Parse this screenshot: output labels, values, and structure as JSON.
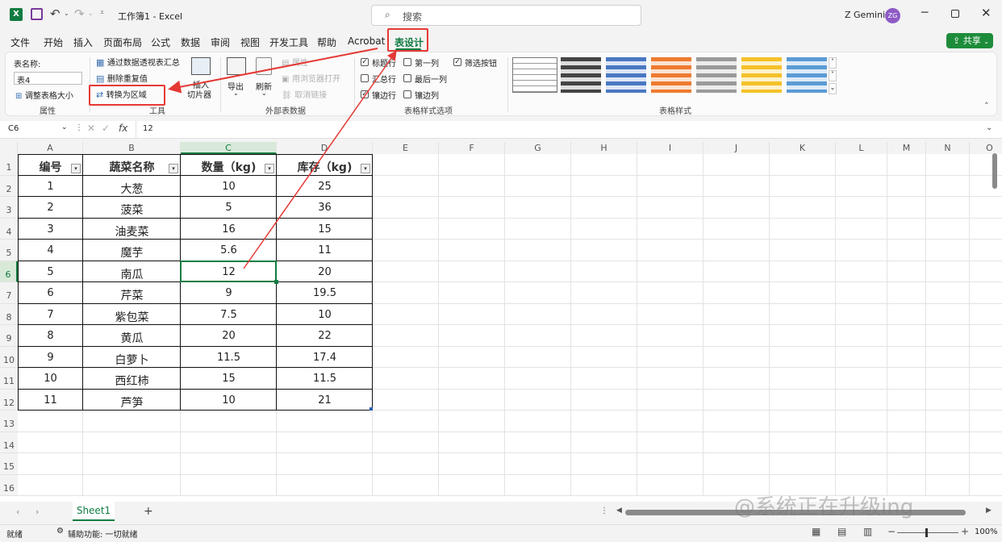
{
  "titlebar": {
    "doc_title": "工作簿1 - Excel",
    "search_placeholder": "搜索",
    "user_name": "Z Gemini",
    "user_initials": "ZG"
  },
  "menu": [
    "文件",
    "开始",
    "插入",
    "页面布局",
    "公式",
    "数据",
    "审阅",
    "视图",
    "开发工具",
    "帮助",
    "Acrobat",
    "表设计"
  ],
  "share_label": "共享",
  "ribbon": {
    "table_name_label": "表名称:",
    "table_name_value": "表4",
    "resize_table": "调整表格大小",
    "group_properties": "属性",
    "pivot_summary": "通过数据透视表汇总",
    "remove_duplicates": "删除重复值",
    "convert_to_range": "转换为区域",
    "insert_slicer_top": "插入",
    "insert_slicer": "切片器",
    "group_tools": "工具",
    "export": "导出",
    "refresh": "刷新",
    "properties": "属性",
    "open_in_browser": "用浏览器打开",
    "unlink": "取消链接",
    "group_external": "外部表数据",
    "header_row": "标题行",
    "total_row": "汇总行",
    "banded_rows": "镶边行",
    "first_column": "第一列",
    "last_column": "最后一列",
    "banded_columns": "镶边列",
    "filter_button": "筛选按钮",
    "group_style_options": "表格样式选项",
    "group_table_styles": "表格样式"
  },
  "formula_bar": {
    "name_box": "C6",
    "fx": "fx",
    "value": "12"
  },
  "columns": [
    "A",
    "B",
    "C",
    "D",
    "E",
    "F",
    "G",
    "H",
    "I",
    "J",
    "K",
    "L",
    "M",
    "N",
    "O"
  ],
  "rows": [
    "1",
    "2",
    "3",
    "4",
    "5",
    "6",
    "7",
    "8",
    "9",
    "10",
    "11",
    "12",
    "13",
    "14",
    "15",
    "16"
  ],
  "table": {
    "headers": [
      "编号",
      "蔬菜名称",
      "数量（kg)",
      "库存（kg)"
    ],
    "rows": [
      [
        "1",
        "大葱",
        "10",
        "25"
      ],
      [
        "2",
        "菠菜",
        "5",
        "36"
      ],
      [
        "3",
        "油麦菜",
        "16",
        "15"
      ],
      [
        "4",
        "魔芋",
        "5.6",
        "11"
      ],
      [
        "5",
        "南瓜",
        "12",
        "20"
      ],
      [
        "6",
        "芹菜",
        "9",
        "19.5"
      ],
      [
        "7",
        "紫包菜",
        "7.5",
        "10"
      ],
      [
        "8",
        "黄瓜",
        "20",
        "22"
      ],
      [
        "9",
        "白萝卜",
        "11.5",
        "17.4"
      ],
      [
        "10",
        "西红柿",
        "15",
        "11.5"
      ],
      [
        "11",
        "芦笋",
        "10",
        "21"
      ]
    ]
  },
  "sheet_tab": "Sheet1",
  "add_sheet": "+",
  "status": {
    "ready": "就绪",
    "accessibility": "辅助功能: 一切就绪",
    "zoom": "100%"
  },
  "watermark": "@系统正在升级ing",
  "colors": {
    "excel_green": "#107c41",
    "highlight_red": "#e53935",
    "share_green": "#1d8c3a"
  }
}
